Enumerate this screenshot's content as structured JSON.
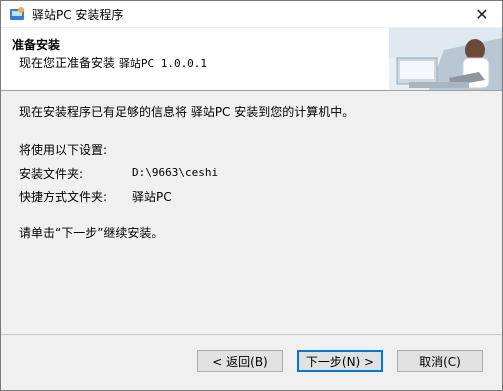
{
  "window": {
    "title": "驿站PC 安装程序",
    "close_glyph": "✕"
  },
  "header": {
    "title": "准备安装",
    "subtitle_prefix": "现在您正准备安装 ",
    "subtitle_app": "驿站PC 1.0.0.1"
  },
  "body": {
    "intro": "现在安装程序已有足够的信息将 驿站PC 安装到您的计算机中。",
    "settings_heading": "将使用以下设置:",
    "install_folder_label": "安装文件夹:",
    "install_folder_value": "D:\\9663\\ceshi",
    "shortcut_folder_label": "快捷方式文件夹:",
    "shortcut_folder_value": "驿站PC",
    "instruction": "请单击“下一步”继续安装。"
  },
  "buttons": {
    "back": "< 返回(B)",
    "next": "下一步(N) >",
    "cancel": "取消(C)"
  },
  "colors": {
    "accent": "#0078d7",
    "button_bg": "#e1e1e1",
    "window_bg": "#f0f0f0"
  }
}
